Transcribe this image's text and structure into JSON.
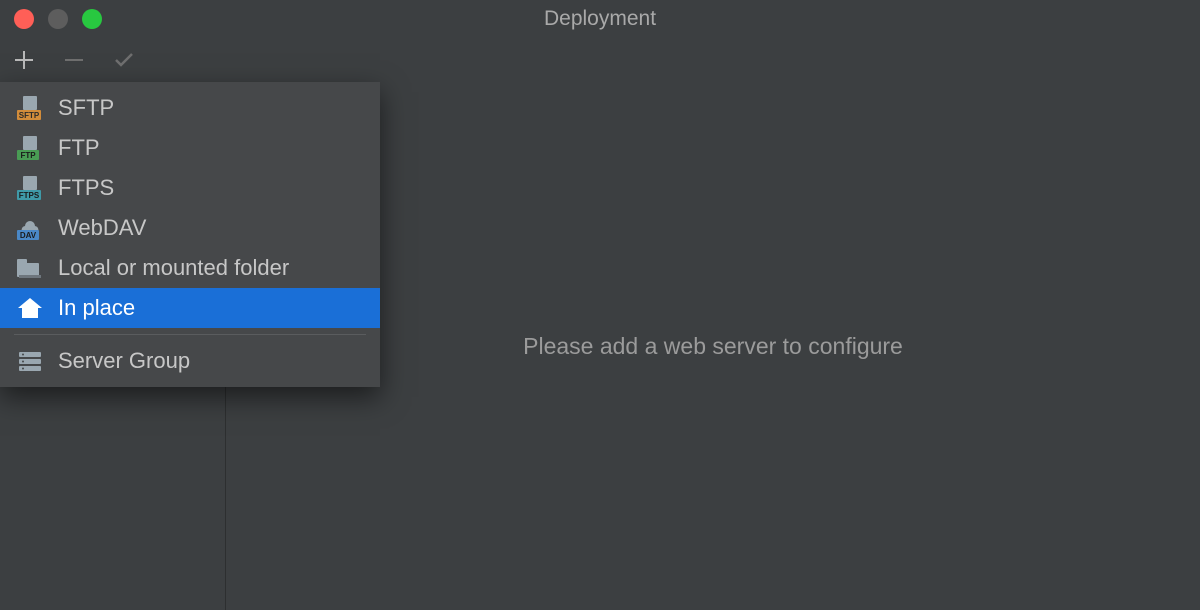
{
  "window": {
    "title": "Deployment"
  },
  "toolbar": {
    "add": "add-button",
    "remove": "remove-button",
    "apply": "apply-button"
  },
  "main": {
    "placeholder": "Please add a web server to configure"
  },
  "add_menu": {
    "items": [
      {
        "label": "SFTP",
        "icon": "sftp-icon"
      },
      {
        "label": "FTP",
        "icon": "ftp-icon"
      },
      {
        "label": "FTPS",
        "icon": "ftps-icon"
      },
      {
        "label": "WebDAV",
        "icon": "webdav-icon"
      },
      {
        "label": "Local or mounted folder",
        "icon": "folder-icon"
      },
      {
        "label": "In place",
        "icon": "home-icon"
      }
    ],
    "selected_index": 5,
    "group_label": "Server Group",
    "group_icon": "server-group-icon"
  }
}
